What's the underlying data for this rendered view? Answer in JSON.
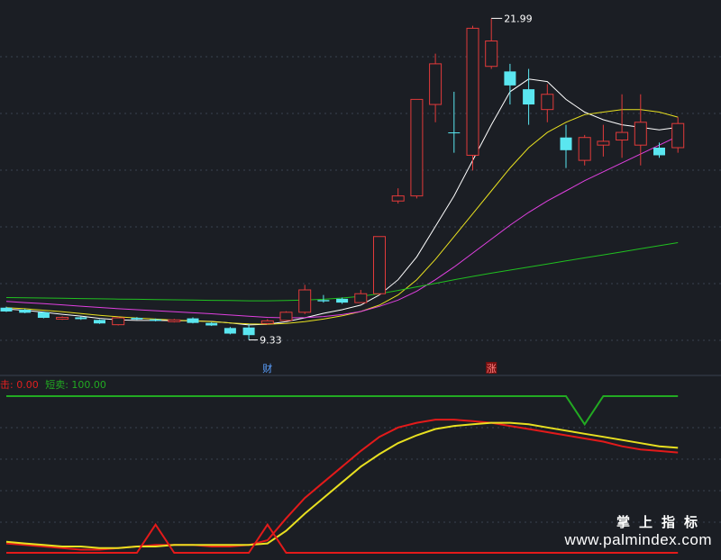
{
  "chart_data": [
    {
      "type": "candlestick",
      "ylim": [
        8.5,
        22.5
      ],
      "annotations": {
        "high": "21.99",
        "low": "9.33"
      },
      "markers": [
        {
          "index": 14,
          "label": "财",
          "color": "#5aa0ff"
        },
        {
          "index": 26,
          "label": "涨",
          "color": "#ff8080",
          "bg": "#7a1010"
        }
      ],
      "candles": [
        {
          "o": 10.6,
          "c": 10.45,
          "h": 10.64,
          "l": 10.43
        },
        {
          "o": 10.52,
          "c": 10.4,
          "h": 10.55,
          "l": 10.38
        },
        {
          "o": 10.42,
          "c": 10.2,
          "h": 10.45,
          "l": 10.18
        },
        {
          "o": 10.15,
          "c": 10.22,
          "h": 10.26,
          "l": 10.12
        },
        {
          "o": 10.22,
          "c": 10.15,
          "h": 10.25,
          "l": 10.12
        },
        {
          "o": 10.12,
          "c": 9.98,
          "h": 10.14,
          "l": 9.96
        },
        {
          "o": 9.93,
          "c": 10.2,
          "h": 10.24,
          "l": 9.9
        },
        {
          "o": 10.2,
          "c": 10.14,
          "h": 10.23,
          "l": 10.12
        },
        {
          "o": 10.14,
          "c": 10.08,
          "h": 10.17,
          "l": 10.06
        },
        {
          "o": 10.05,
          "c": 10.12,
          "h": 10.16,
          "l": 10.02
        },
        {
          "o": 10.18,
          "c": 10.0,
          "h": 10.22,
          "l": 9.98
        },
        {
          "o": 10.0,
          "c": 9.9,
          "h": 10.03,
          "l": 9.88
        },
        {
          "o": 9.8,
          "c": 9.58,
          "h": 9.84,
          "l": 9.55
        },
        {
          "o": 9.82,
          "c": 9.52,
          "h": 9.95,
          "l": 9.33
        },
        {
          "o": 9.98,
          "c": 10.08,
          "h": 10.15,
          "l": 9.93
        },
        {
          "o": 10.1,
          "c": 10.42,
          "h": 10.46,
          "l": 10.08
        },
        {
          "o": 10.42,
          "c": 11.3,
          "h": 11.5,
          "l": 10.35
        },
        {
          "o": 10.9,
          "c": 10.85,
          "h": 11.1,
          "l": 10.8
        },
        {
          "o": 10.95,
          "c": 10.8,
          "h": 11.0,
          "l": 10.75
        },
        {
          "o": 10.8,
          "c": 11.15,
          "h": 11.3,
          "l": 10.8
        },
        {
          "o": 11.15,
          "c": 13.4,
          "h": 13.4,
          "l": 11.1
        },
        {
          "o": 14.8,
          "c": 15.0,
          "h": 15.3,
          "l": 14.7
        },
        {
          "o": 15.0,
          "c": 18.8,
          "h": 18.8,
          "l": 14.9
        },
        {
          "o": 18.6,
          "c": 20.2,
          "h": 20.6,
          "l": 17.9
        },
        {
          "o": 17.5,
          "c": 17.48,
          "h": 19.1,
          "l": 16.7
        },
        {
          "o": 16.6,
          "c": 21.6,
          "h": 21.7,
          "l": 16.0
        },
        {
          "o": 20.1,
          "c": 21.1,
          "h": 21.99,
          "l": 20.0
        },
        {
          "o": 19.9,
          "c": 19.35,
          "h": 20.2,
          "l": 18.6
        },
        {
          "o": 19.2,
          "c": 18.6,
          "h": 20.0,
          "l": 17.8
        },
        {
          "o": 18.4,
          "c": 19.0,
          "h": 19.4,
          "l": 17.9
        },
        {
          "o": 17.3,
          "c": 16.8,
          "h": 17.8,
          "l": 16.1
        },
        {
          "o": 16.4,
          "c": 17.3,
          "h": 17.4,
          "l": 16.2
        },
        {
          "o": 17.0,
          "c": 17.15,
          "h": 17.8,
          "l": 16.55
        },
        {
          "o": 17.2,
          "c": 17.5,
          "h": 19.0,
          "l": 16.5
        },
        {
          "o": 17.0,
          "c": 17.9,
          "h": 19.0,
          "l": 16.2
        },
        {
          "o": 16.9,
          "c": 16.6,
          "h": 17.1,
          "l": 16.5
        },
        {
          "o": 16.9,
          "c": 17.85,
          "h": 18.1,
          "l": 16.7
        }
      ],
      "series": [
        {
          "color": "#ffffff",
          "values": [
            10.55,
            10.5,
            10.42,
            10.34,
            10.27,
            10.18,
            10.12,
            10.1,
            10.1,
            10.09,
            10.08,
            10.06,
            10.0,
            9.92,
            9.95,
            10.05,
            10.2,
            10.38,
            10.52,
            10.7,
            11.1,
            11.7,
            12.6,
            13.8,
            15.0,
            16.4,
            17.8,
            19.1,
            19.6,
            19.5,
            18.8,
            18.3,
            18.0,
            17.8,
            17.7,
            17.6,
            17.7
          ]
        },
        {
          "color": "#e8e020",
          "values": [
            10.6,
            10.56,
            10.5,
            10.44,
            10.37,
            10.3,
            10.24,
            10.19,
            10.15,
            10.11,
            10.08,
            10.05,
            10.0,
            9.96,
            9.95,
            9.98,
            10.05,
            10.15,
            10.28,
            10.45,
            10.7,
            11.1,
            11.7,
            12.5,
            13.4,
            14.3,
            15.2,
            16.1,
            16.9,
            17.5,
            17.9,
            18.2,
            18.3,
            18.4,
            18.4,
            18.3,
            18.1
          ]
        },
        {
          "color": "#e040e0",
          "values": [
            10.85,
            10.8,
            10.76,
            10.71,
            10.66,
            10.61,
            10.56,
            10.52,
            10.48,
            10.44,
            10.4,
            10.36,
            10.31,
            10.26,
            10.22,
            10.2,
            10.21,
            10.25,
            10.33,
            10.45,
            10.65,
            10.9,
            11.25,
            11.7,
            12.2,
            12.75,
            13.3,
            13.85,
            14.35,
            14.8,
            15.2,
            15.6,
            15.95,
            16.3,
            16.65,
            17.0,
            17.35
          ]
        },
        {
          "color": "#20c020",
          "values": [
            11.0,
            10.99,
            10.98,
            10.97,
            10.96,
            10.95,
            10.94,
            10.93,
            10.92,
            10.91,
            10.9,
            10.89,
            10.88,
            10.87,
            10.87,
            10.88,
            10.9,
            10.93,
            10.98,
            11.05,
            11.15,
            11.28,
            11.42,
            11.56,
            11.7,
            11.83,
            11.96,
            12.08,
            12.2,
            12.32,
            12.44,
            12.56,
            12.68,
            12.8,
            12.92,
            13.04,
            13.16
          ]
        }
      ]
    },
    {
      "type": "line",
      "legend": {
        "label1": "击: 0.00",
        "label2": "短卖: 100.00"
      },
      "ylim": [
        0,
        100
      ],
      "series": [
        {
          "color": "#e31a1a",
          "values": [
            6,
            5,
            4,
            3,
            2,
            2,
            3,
            4,
            5,
            5,
            5,
            4,
            4,
            5,
            8,
            22,
            35,
            45,
            55,
            65,
            74,
            80,
            83,
            85,
            85,
            84,
            83,
            81,
            79,
            77,
            75,
            73,
            71,
            68,
            66,
            65,
            64
          ]
        },
        {
          "color": "#e8e020",
          "values": [
            7,
            6,
            5,
            4,
            4,
            3,
            3,
            4,
            4,
            5,
            5,
            5,
            5,
            5,
            6,
            14,
            25,
            35,
            45,
            55,
            63,
            70,
            75,
            79,
            81,
            82,
            83,
            83,
            82,
            80,
            78,
            76,
            74,
            72,
            70,
            68,
            67
          ]
        },
        {
          "color": "#22aa22",
          "values": [
            100,
            100,
            100,
            100,
            100,
            100,
            100,
            100,
            100,
            100,
            100,
            100,
            100,
            100,
            100,
            100,
            100,
            100,
            100,
            100,
            100,
            100,
            100,
            100,
            100,
            100,
            100,
            100,
            100,
            100,
            100,
            82,
            100,
            100,
            100,
            100,
            100
          ]
        },
        {
          "color": "#e31a1a",
          "values": [
            0,
            0,
            0,
            0,
            0,
            0,
            0,
            0,
            18,
            0,
            0,
            0,
            0,
            0,
            18,
            0,
            0,
            0,
            0,
            0,
            0,
            0,
            0,
            0,
            0,
            0,
            0,
            0,
            0,
            0,
            0,
            0,
            0,
            0,
            0,
            0,
            0
          ]
        }
      ]
    }
  ],
  "watermark": {
    "cn": "掌上指标",
    "url": "www.palmindex.com"
  }
}
